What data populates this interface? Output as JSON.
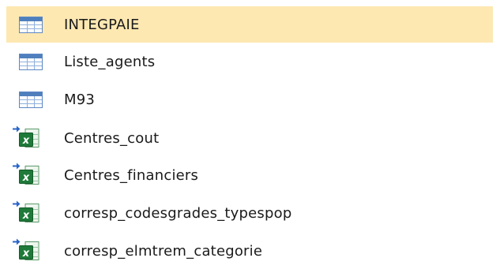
{
  "navigation_pane": {
    "items": [
      {
        "label": "INTEGPAIE",
        "type": "table",
        "selected": true
      },
      {
        "label": "Liste_agents",
        "type": "table",
        "selected": false
      },
      {
        "label": "M93",
        "type": "table",
        "selected": false
      },
      {
        "label": "Centres_cout",
        "type": "linked-excel",
        "selected": false
      },
      {
        "label": "Centres_financiers",
        "type": "linked-excel",
        "selected": false
      },
      {
        "label": "corresp_codesgrades_typespop",
        "type": "linked-excel",
        "selected": false
      },
      {
        "label": "corresp_elmtrem_categorie",
        "type": "linked-excel",
        "selected": false
      }
    ],
    "icons": {
      "table": "table-icon",
      "linked-excel": "linked-excel-table-icon"
    },
    "colors": {
      "selection": "#fde8b2",
      "table_icon_header": "#4f7fbd",
      "excel_green": "#1f7a3a",
      "link_arrow": "#2b66c7"
    }
  }
}
